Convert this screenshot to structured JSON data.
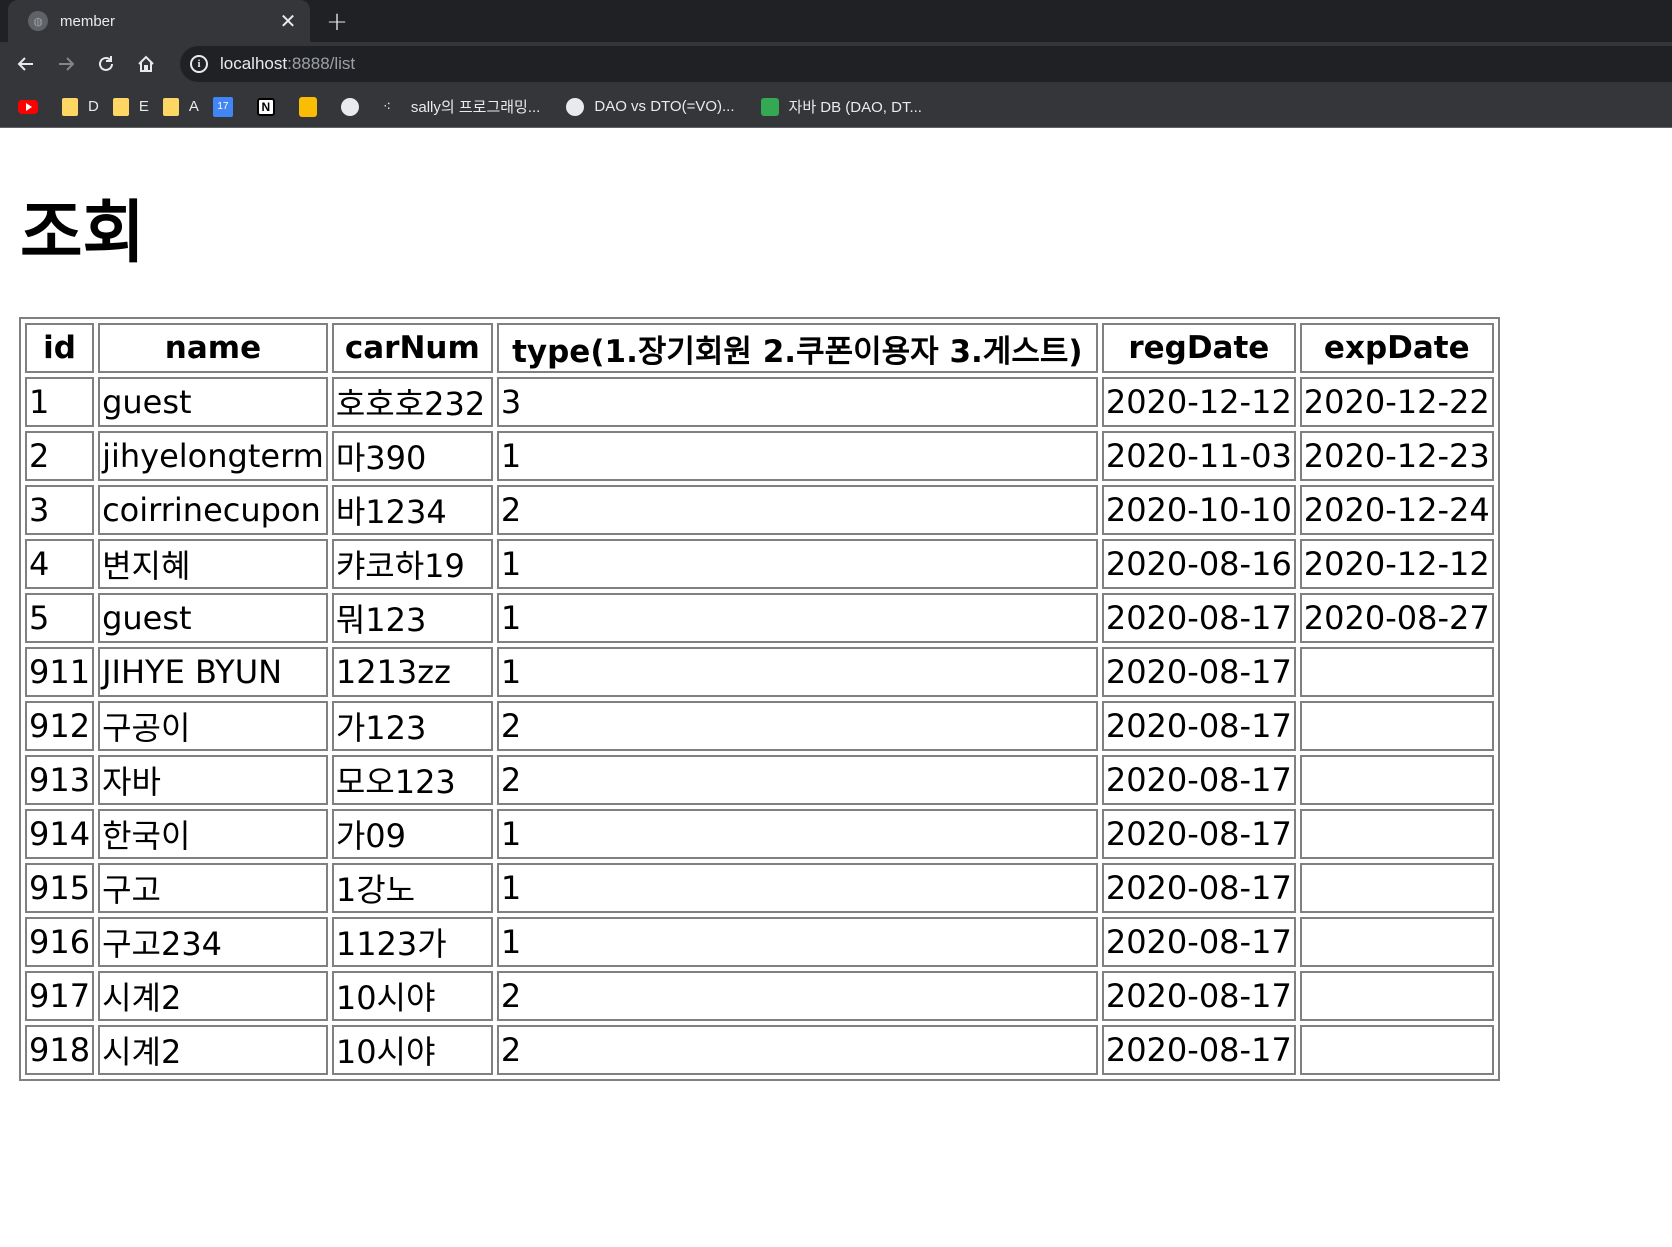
{
  "browser": {
    "tab_title": "member",
    "url_host": "localhost",
    "url_path": ":8888/list",
    "new_tab_symbol": "+",
    "close_symbol": "✕",
    "bookmarks": [
      {
        "label": "",
        "icon": "youtube-icon"
      },
      {
        "label": "D",
        "icon": "folder-icon"
      },
      {
        "label": "E",
        "icon": "folder-icon"
      },
      {
        "label": "A",
        "icon": "folder-icon"
      },
      {
        "label": "",
        "icon": "calendar-icon",
        "glyph": "17"
      },
      {
        "label": "",
        "icon": "notion-icon",
        "glyph": "N"
      },
      {
        "label": "",
        "icon": "keep-icon"
      },
      {
        "label": "",
        "icon": "globe-icon"
      },
      {
        "label": "sally의 프로그래밍...",
        "icon": "dots-icon"
      },
      {
        "label": "DAO vs DTO(=VO)...",
        "icon": "globe-icon"
      },
      {
        "label": "자바 DB (DAO, DT...",
        "icon": "chat-icon"
      }
    ]
  },
  "page": {
    "title": "조회",
    "table": {
      "headers": [
        "id",
        "name",
        "carNum",
        "type(1.장기회원 2.쿠폰이용자 3.게스트)",
        "regDate",
        "expDate"
      ],
      "rows": [
        [
          "1",
          "guest",
          "호호호232",
          "3",
          "2020-12-12",
          "2020-12-22"
        ],
        [
          "2",
          "jihyelongterm",
          "마390",
          "1",
          "2020-11-03",
          "2020-12-23"
        ],
        [
          "3",
          "coirrinecupon",
          "바1234",
          "2",
          "2020-10-10",
          "2020-12-24"
        ],
        [
          "4",
          "변지혜",
          "캬코하19",
          "1",
          "2020-08-16",
          "2020-12-12"
        ],
        [
          "5",
          "guest",
          "뭐123",
          "1",
          "2020-08-17",
          "2020-08-27"
        ],
        [
          "911",
          "JIHYE BYUN",
          "1213zz",
          "1",
          "2020-08-17",
          ""
        ],
        [
          "912",
          "구공이",
          "가123",
          "2",
          "2020-08-17",
          ""
        ],
        [
          "913",
          "자바",
          "모오123",
          "2",
          "2020-08-17",
          ""
        ],
        [
          "914",
          "한국이",
          "가09",
          "1",
          "2020-08-17",
          ""
        ],
        [
          "915",
          "구고",
          "1강노",
          "1",
          "2020-08-17",
          ""
        ],
        [
          "916",
          "구고234",
          "1123가",
          "1",
          "2020-08-17",
          ""
        ],
        [
          "917",
          "시계2",
          "10시야",
          "2",
          "2020-08-17",
          ""
        ],
        [
          "918",
          "시계2",
          "10시야",
          "2",
          "2020-08-17",
          ""
        ]
      ]
    }
  }
}
